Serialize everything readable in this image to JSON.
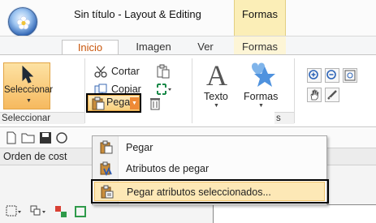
{
  "window": {
    "title": "Sin título - Layout & Editing",
    "context_tab_title": "Formas"
  },
  "tabs": [
    {
      "label": "Inicio",
      "active": true
    },
    {
      "label": "Imagen",
      "active": false
    },
    {
      "label": "Ver",
      "active": false
    },
    {
      "label": "Formas",
      "active": false
    }
  ],
  "ribbon": {
    "select_label": "Seleccionar",
    "cut_label": "Cortar",
    "copy_label": "Copiar",
    "paste_label": "Pegar",
    "text_label": "Texto",
    "shapes_label": "Formas",
    "group_select_label": "Seleccionar",
    "group_shapes_label_fragment": "s"
  },
  "paste_menu": {
    "items": [
      {
        "label": "Pegar",
        "highlighted": false
      },
      {
        "label": "Atributos de pegar",
        "highlighted": false
      },
      {
        "label": "Pegar atributos seleccionados...",
        "highlighted": true
      }
    ]
  },
  "order_bar": {
    "label": "Orden de cost"
  },
  "colors": {
    "accent_orange": "#f6b95f",
    "highlight": "#fde8b6",
    "context_tab": "#fbeeb7"
  }
}
